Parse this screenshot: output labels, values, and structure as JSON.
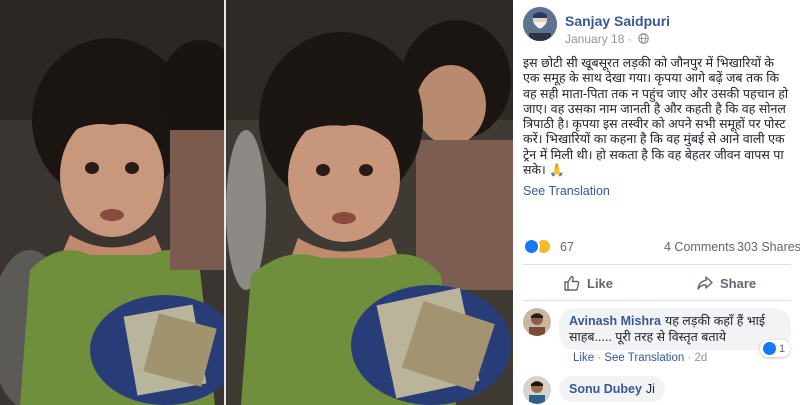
{
  "post": {
    "author": "Sanjay Saidpuri",
    "date": "January 18",
    "privacy_icon": "globe-icon",
    "text": "इस छोटी सी खूबसूरत लड़की को जौनपुर में भिखारियों के एक समूह के साथ देखा गया। कृपया आगे बढ़ें जब तक कि वह सही माता-पिता तक न पहुंच जाए और उसकी पहचान हो जाए। वह उसका नाम जानती है और कहती है कि वह सोनल त्रिपाठी है। कृपया इस तस्वीर को अपने सभी समूहों पर पोस्ट करें। भिखारियों का कहना है कि वह मुंबई से आने वाली एक ट्रेन में मिली थी। हो सकता है कि वह बेहतर जीवन वापस पा सके। 🙏",
    "see_translation": "See Translation"
  },
  "reactions": {
    "icons": [
      "like-reaction-icon",
      "sad-reaction-icon"
    ],
    "count": "67",
    "comments": "4 Comments",
    "shares": "303 Shares"
  },
  "actions": {
    "like_label": "Like",
    "share_label": "Share"
  },
  "comments": [
    {
      "author": "Avinash Mishra",
      "text": "यह लड़की कहाँ हैं भाई साहब..... पूरी तरह से विस्तृत बताये",
      "like_link": "Like",
      "translation_link": "See Translation",
      "age": "2d",
      "reaction_count": "1"
    },
    {
      "author": "Sonu Dubey",
      "text": "Ji"
    }
  ],
  "colors": {
    "link": "#385898",
    "like_blue": "#1877f2",
    "sad_yellow": "#f7b928",
    "bubble": "#f2f3f5"
  }
}
